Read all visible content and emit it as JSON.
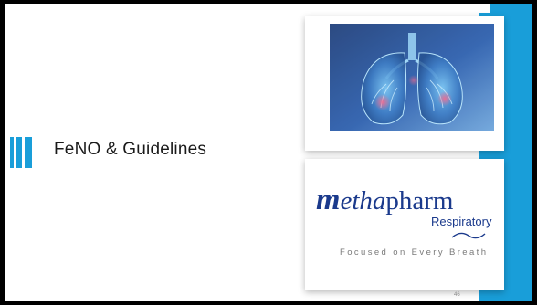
{
  "slide": {
    "title": "FeNO & Guidelines",
    "page_number": "46"
  },
  "images": {
    "lungs": "lungs-illustration",
    "logo": {
      "brand_m": "m",
      "brand_etha": "etha",
      "brand_pharm": "pharm",
      "subtitle": "Respiratory",
      "tagline": "Focused on Every Breath"
    }
  },
  "colors": {
    "accent": "#199ed9",
    "brand_navy": "#1b3a8c",
    "background": "#000000"
  }
}
